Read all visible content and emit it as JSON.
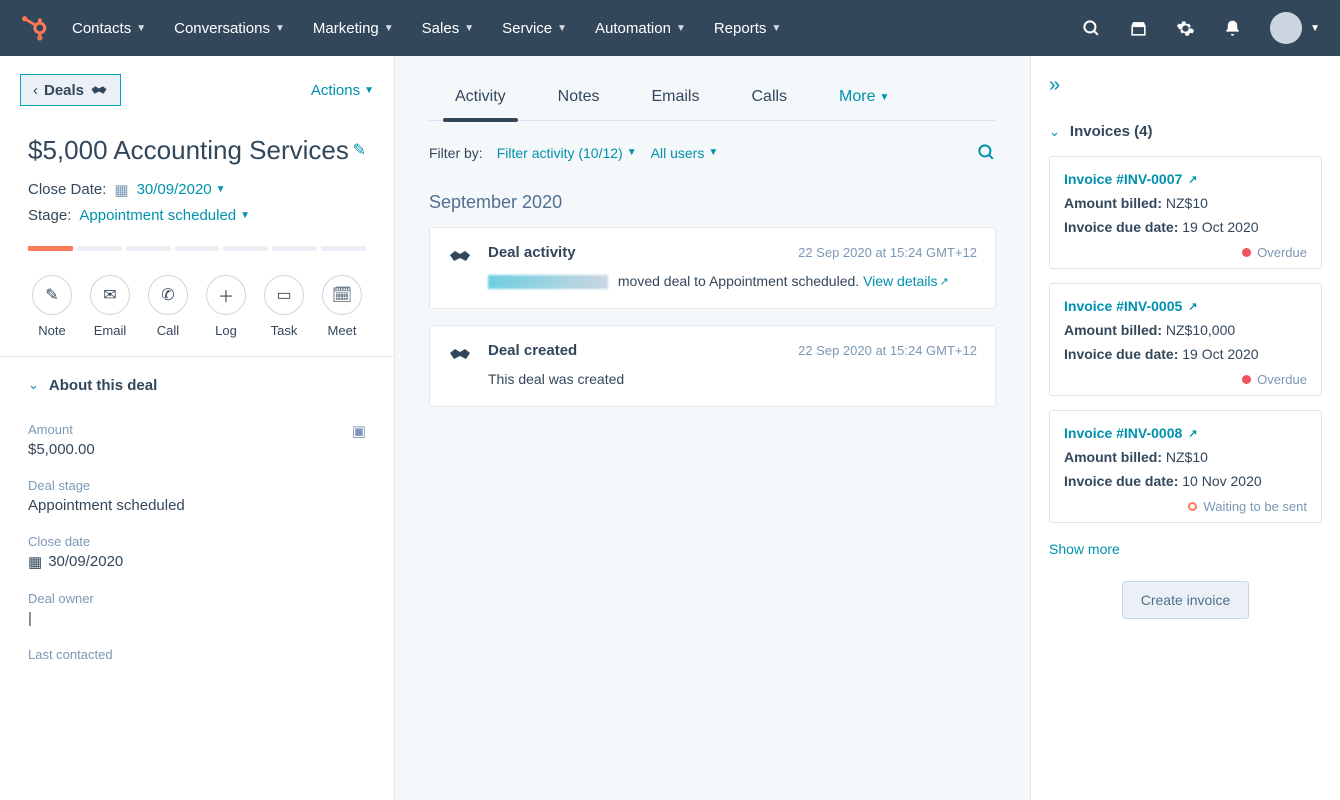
{
  "nav": {
    "items": [
      "Contacts",
      "Conversations",
      "Marketing",
      "Sales",
      "Service",
      "Automation",
      "Reports"
    ]
  },
  "left": {
    "back_label": "Deals",
    "actions_label": "Actions",
    "deal_title": "$5,000 Accounting Services",
    "close_date_label": "Close Date:",
    "close_date_value": "30/09/2020",
    "stage_label": "Stage:",
    "stage_value": "Appointment scheduled",
    "action_buttons": [
      {
        "icon": "note",
        "label": "Note"
      },
      {
        "icon": "mail",
        "label": "Email"
      },
      {
        "icon": "phone",
        "label": "Call"
      },
      {
        "icon": "plus",
        "label": "Log"
      },
      {
        "icon": "calendar",
        "label": "Task"
      },
      {
        "icon": "schedule",
        "label": "Meet"
      }
    ],
    "about_section": "About this deal",
    "fields": {
      "amount_label": "Amount",
      "amount_value": "$5,000.00",
      "stage_label": "Deal stage",
      "stage_value": "Appointment scheduled",
      "close_label": "Close date",
      "close_value": "30/09/2020",
      "owner_label": "Deal owner",
      "owner_value": "|",
      "last_contacted_label": "Last contacted"
    }
  },
  "center": {
    "tabs": [
      "Activity",
      "Notes",
      "Emails",
      "Calls"
    ],
    "more_label": "More",
    "filter_by": "Filter by:",
    "filter_activity": "Filter activity (10/12)",
    "all_users": "All users",
    "month_heading": "September 2020",
    "activities": [
      {
        "title": "Deal activity",
        "time": "22 Sep 2020 at 15:24 GMT+12",
        "text_after": "moved deal to Appointment scheduled. ",
        "view": "View details",
        "has_blur": true
      },
      {
        "title": "Deal created",
        "time": "22 Sep 2020 at 15:24 GMT+12",
        "text": "This deal was created"
      }
    ]
  },
  "right": {
    "invoices_header": "Invoices (4)",
    "invoices": [
      {
        "link": "Invoice #INV-0007",
        "billed_label": "Amount billed:",
        "billed_value": "NZ$10",
        "due_label": "Invoice due date:",
        "due_value": "19 Oct 2020",
        "status": "Overdue",
        "status_kind": "red"
      },
      {
        "link": "Invoice #INV-0005",
        "billed_label": "Amount billed:",
        "billed_value": "NZ$10,000",
        "due_label": "Invoice due date:",
        "due_value": "19 Oct 2020",
        "status": "Overdue",
        "status_kind": "red"
      },
      {
        "link": "Invoice #INV-0008",
        "billed_label": "Amount billed:",
        "billed_value": "NZ$10",
        "due_label": "Invoice due date:",
        "due_value": "10 Nov 2020",
        "status": "Waiting to be sent",
        "status_kind": "open"
      }
    ],
    "show_more": "Show more",
    "create_invoice": "Create invoice"
  }
}
